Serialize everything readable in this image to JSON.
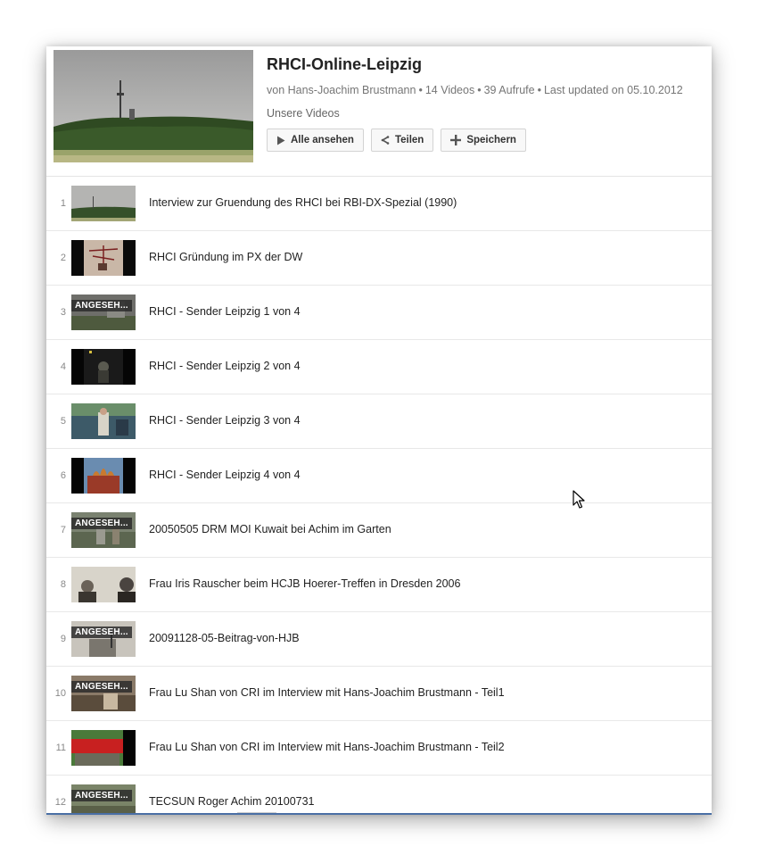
{
  "playlist": {
    "title": "RHCI-Online-Leipzig",
    "owner": "von Hans-Joachim Brustmann",
    "video_count": "14 Videos",
    "views": "39 Aufrufe",
    "updated": "Last updated on 05.10.2012",
    "separator": "•",
    "description": "Unsere Videos"
  },
  "actions": {
    "play_all": "Alle ansehen",
    "share": "Teilen",
    "save": "Speichern"
  },
  "videos": [
    {
      "index": "1",
      "title": "Interview zur Gruendung des RHCI bei RBI-DX-Spezial (1990)",
      "badge": ""
    },
    {
      "index": "2",
      "title": "RHCI Gründung im PX der DW",
      "badge": ""
    },
    {
      "index": "3",
      "title": "RHCI - Sender Leipzig 1 von 4",
      "badge": "ANGESEH..."
    },
    {
      "index": "4",
      "title": "RHCI - Sender Leipzig 2 von 4",
      "badge": ""
    },
    {
      "index": "5",
      "title": "RHCI - Sender Leipzig 3 von 4",
      "badge": ""
    },
    {
      "index": "6",
      "title": "RHCI - Sender Leipzig 4 von 4",
      "badge": ""
    },
    {
      "index": "7",
      "title": "20050505 DRM MOI Kuwait bei Achim im Garten",
      "badge": "ANGESEH..."
    },
    {
      "index": "8",
      "title": "Frau Iris Rauscher beim HCJB Hoerer-Treffen in Dresden 2006",
      "badge": ""
    },
    {
      "index": "9",
      "title": "20091128-05-Beitrag-von-HJB",
      "badge": "ANGESEH..."
    },
    {
      "index": "10",
      "title": "Frau Lu Shan von CRI im Interview mit Hans-Joachim Brustmann - Teil1",
      "badge": "ANGESEH..."
    },
    {
      "index": "11",
      "title": "Frau Lu Shan von CRI im Interview mit Hans-Joachim Brustmann - Teil2",
      "badge": ""
    },
    {
      "index": "12",
      "title": "TECSUN Roger Achim 20100731",
      "badge": "ANGESEH..."
    }
  ],
  "colors": {
    "accent": "#4a6fa5",
    "text": "#222222",
    "meta": "#767676",
    "border": "#e8e8e8"
  }
}
